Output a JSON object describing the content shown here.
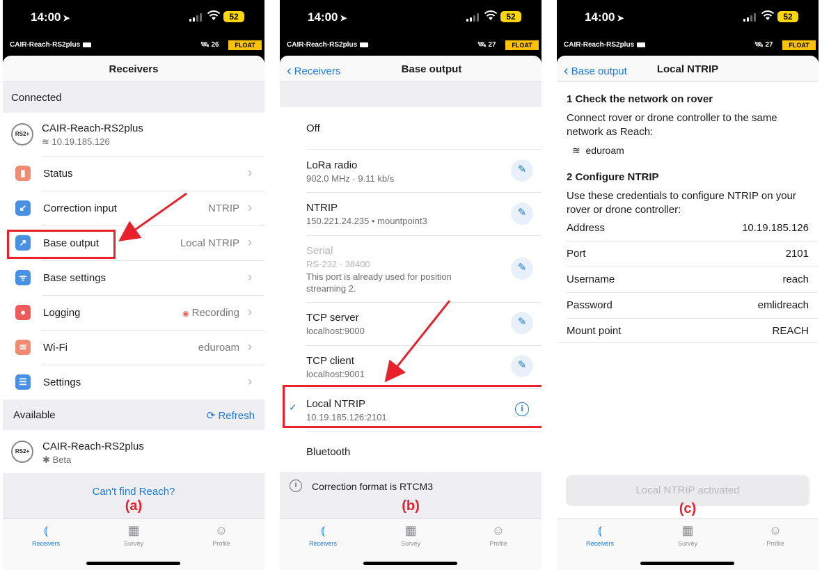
{
  "status_bar": {
    "time": "14:00",
    "battery": "52"
  },
  "receiver_bar": {
    "name": "CAIR-Reach-RS2plus",
    "float": "FLOAT",
    "sat_p1": "26",
    "sat_p2": "27",
    "sat_p3": "27"
  },
  "tabs": [
    {
      "label": "Receivers"
    },
    {
      "label": "Survey"
    },
    {
      "label": "Profile"
    }
  ],
  "panel_a": {
    "title": "Receivers",
    "connected_header": "Connected",
    "receiver": {
      "badge": "RS2+",
      "name": "CAIR-Reach-RS2plus",
      "ip": "10.19.185.126"
    },
    "items": [
      {
        "label": "Status",
        "value": ""
      },
      {
        "label": "Correction input",
        "value": "NTRIP"
      },
      {
        "label": "Base output",
        "value": "Local NTRIP"
      },
      {
        "label": "Base settings",
        "value": ""
      },
      {
        "label": "Logging",
        "value": "Recording"
      },
      {
        "label": "Wi-Fi",
        "value": "eduroam"
      },
      {
        "label": "Settings",
        "value": ""
      }
    ],
    "available_header": "Available",
    "refresh": "Refresh",
    "available_receiver": {
      "badge": "RS2+",
      "name": "CAIR-Reach-RS2plus",
      "sub": "Beta"
    },
    "cant_find": "Can't find Reach?",
    "annotation": "(a)",
    "colors": {
      "status": "#f28b74",
      "correction": "#4a90e2",
      "base_output": "#4a90e2",
      "base_settings": "#4a90e2",
      "logging": "#ef5b5b",
      "wifi": "#f28b74",
      "settings": "#4a90e2"
    }
  },
  "panel_b": {
    "back": "Receivers",
    "title": "Base output",
    "options": [
      {
        "title": "Off",
        "sub": ""
      },
      {
        "title": "LoRa radio",
        "sub": "902.0 MHz · 9.11 kb/s"
      },
      {
        "title": "NTRIP",
        "sub": "150.221.24.235 • mountpoint3"
      },
      {
        "title": "Serial",
        "sub": "RS-232 · 38400",
        "note": "This port is already used for position streaming 2."
      },
      {
        "title": "TCP server",
        "sub": "localhost:9000"
      },
      {
        "title": "TCP client",
        "sub": "localhost:9001"
      },
      {
        "title": "Local NTRIP",
        "sub": "10.19.185.126:2101"
      },
      {
        "title": "Bluetooth",
        "sub": ""
      }
    ],
    "footer": "Correction format is RTCM3",
    "annotation": "(b)"
  },
  "panel_c": {
    "back": "Base output",
    "title": "Local NTRIP",
    "step1_title": "1 Check the network on rover",
    "step1_text": "Connect rover or drone controller to the same network as Reach:",
    "network": "eduroam",
    "step2_title": "2 Configure NTRIP",
    "step2_text": "Use these credentials to configure NTRIP on your rover or drone controller:",
    "fields": [
      {
        "label": "Address",
        "value": "10.19.185.126"
      },
      {
        "label": "Port",
        "value": "2101"
      },
      {
        "label": "Username",
        "value": "reach"
      },
      {
        "label": "Password",
        "value": "emlidreach"
      },
      {
        "label": "Mount point",
        "value": "REACH"
      }
    ],
    "button": "Local NTRIP activated",
    "annotation": "(c)"
  }
}
